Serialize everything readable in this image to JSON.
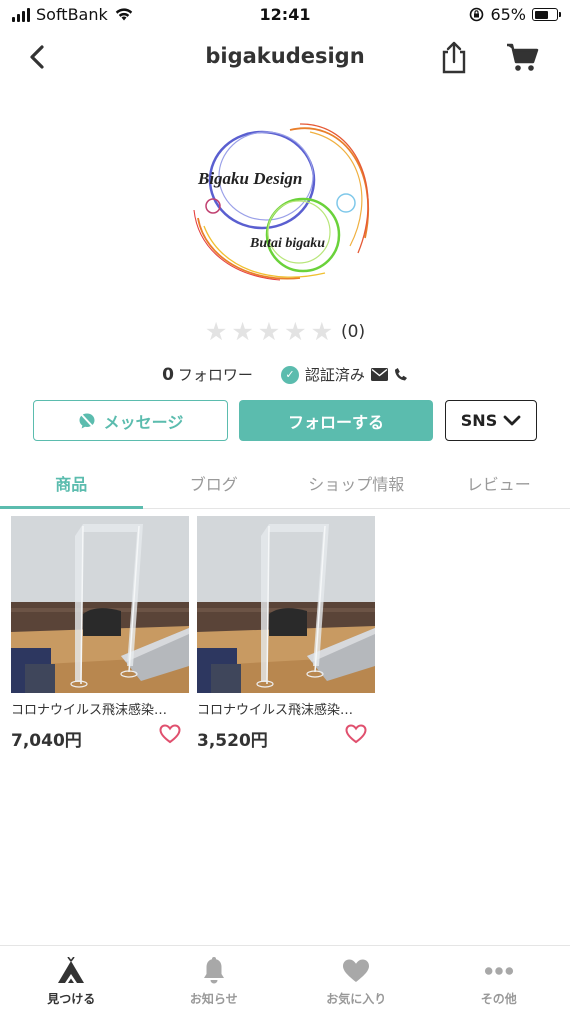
{
  "status_bar": {
    "carrier": "SoftBank",
    "time": "12:41",
    "battery": "65%",
    "battery_level": 0.65
  },
  "header": {
    "title": "bigakudesign"
  },
  "shop": {
    "logo_text_1": "Bigaku Design",
    "logo_text_2": "Butai bigaku",
    "rating_stars": 0,
    "rating_count": "(0)",
    "follower_count": "0",
    "follower_label": "フォロワー",
    "verified_label": "認証済み"
  },
  "buttons": {
    "message": "メッセージ",
    "follow": "フォローする",
    "sns": "SNS"
  },
  "tabs": [
    {
      "label": "商品",
      "active": true
    },
    {
      "label": "ブログ",
      "active": false
    },
    {
      "label": "ショップ情報",
      "active": false
    },
    {
      "label": "レビュー",
      "active": false
    }
  ],
  "products": [
    {
      "title": "コロナウイルス飛沫感染…",
      "price": "7,040円"
    },
    {
      "title": "コロナウイルス飛沫感染…",
      "price": "3,520円"
    }
  ],
  "bottom_nav": [
    {
      "label": "見つける",
      "icon": "tent-icon",
      "active": true
    },
    {
      "label": "お知らせ",
      "icon": "bell-icon",
      "active": false
    },
    {
      "label": "お気に入り",
      "icon": "heart-icon",
      "active": false
    },
    {
      "label": "その他",
      "icon": "more-icon",
      "active": false
    }
  ],
  "colors": {
    "accent": "#5bbcae",
    "heart": "#e0506e",
    "text": "#333333",
    "muted": "#999999"
  }
}
